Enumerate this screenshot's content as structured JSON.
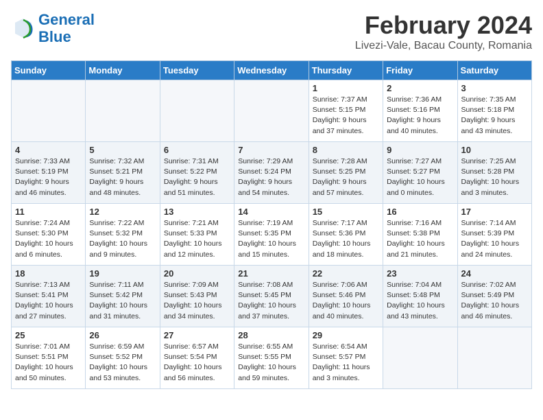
{
  "header": {
    "logo_line1": "General",
    "logo_line2": "Blue",
    "month": "February 2024",
    "location": "Livezi-Vale, Bacau County, Romania"
  },
  "weekdays": [
    "Sunday",
    "Monday",
    "Tuesday",
    "Wednesday",
    "Thursday",
    "Friday",
    "Saturday"
  ],
  "weeks": [
    [
      {
        "day": "",
        "info": ""
      },
      {
        "day": "",
        "info": ""
      },
      {
        "day": "",
        "info": ""
      },
      {
        "day": "",
        "info": ""
      },
      {
        "day": "1",
        "info": "Sunrise: 7:37 AM\nSunset: 5:15 PM\nDaylight: 9 hours\nand 37 minutes."
      },
      {
        "day": "2",
        "info": "Sunrise: 7:36 AM\nSunset: 5:16 PM\nDaylight: 9 hours\nand 40 minutes."
      },
      {
        "day": "3",
        "info": "Sunrise: 7:35 AM\nSunset: 5:18 PM\nDaylight: 9 hours\nand 43 minutes."
      }
    ],
    [
      {
        "day": "4",
        "info": "Sunrise: 7:33 AM\nSunset: 5:19 PM\nDaylight: 9 hours\nand 46 minutes."
      },
      {
        "day": "5",
        "info": "Sunrise: 7:32 AM\nSunset: 5:21 PM\nDaylight: 9 hours\nand 48 minutes."
      },
      {
        "day": "6",
        "info": "Sunrise: 7:31 AM\nSunset: 5:22 PM\nDaylight: 9 hours\nand 51 minutes."
      },
      {
        "day": "7",
        "info": "Sunrise: 7:29 AM\nSunset: 5:24 PM\nDaylight: 9 hours\nand 54 minutes."
      },
      {
        "day": "8",
        "info": "Sunrise: 7:28 AM\nSunset: 5:25 PM\nDaylight: 9 hours\nand 57 minutes."
      },
      {
        "day": "9",
        "info": "Sunrise: 7:27 AM\nSunset: 5:27 PM\nDaylight: 10 hours\nand 0 minutes."
      },
      {
        "day": "10",
        "info": "Sunrise: 7:25 AM\nSunset: 5:28 PM\nDaylight: 10 hours\nand 3 minutes."
      }
    ],
    [
      {
        "day": "11",
        "info": "Sunrise: 7:24 AM\nSunset: 5:30 PM\nDaylight: 10 hours\nand 6 minutes."
      },
      {
        "day": "12",
        "info": "Sunrise: 7:22 AM\nSunset: 5:32 PM\nDaylight: 10 hours\nand 9 minutes."
      },
      {
        "day": "13",
        "info": "Sunrise: 7:21 AM\nSunset: 5:33 PM\nDaylight: 10 hours\nand 12 minutes."
      },
      {
        "day": "14",
        "info": "Sunrise: 7:19 AM\nSunset: 5:35 PM\nDaylight: 10 hours\nand 15 minutes."
      },
      {
        "day": "15",
        "info": "Sunrise: 7:17 AM\nSunset: 5:36 PM\nDaylight: 10 hours\nand 18 minutes."
      },
      {
        "day": "16",
        "info": "Sunrise: 7:16 AM\nSunset: 5:38 PM\nDaylight: 10 hours\nand 21 minutes."
      },
      {
        "day": "17",
        "info": "Sunrise: 7:14 AM\nSunset: 5:39 PM\nDaylight: 10 hours\nand 24 minutes."
      }
    ],
    [
      {
        "day": "18",
        "info": "Sunrise: 7:13 AM\nSunset: 5:41 PM\nDaylight: 10 hours\nand 27 minutes."
      },
      {
        "day": "19",
        "info": "Sunrise: 7:11 AM\nSunset: 5:42 PM\nDaylight: 10 hours\nand 31 minutes."
      },
      {
        "day": "20",
        "info": "Sunrise: 7:09 AM\nSunset: 5:43 PM\nDaylight: 10 hours\nand 34 minutes."
      },
      {
        "day": "21",
        "info": "Sunrise: 7:08 AM\nSunset: 5:45 PM\nDaylight: 10 hours\nand 37 minutes."
      },
      {
        "day": "22",
        "info": "Sunrise: 7:06 AM\nSunset: 5:46 PM\nDaylight: 10 hours\nand 40 minutes."
      },
      {
        "day": "23",
        "info": "Sunrise: 7:04 AM\nSunset: 5:48 PM\nDaylight: 10 hours\nand 43 minutes."
      },
      {
        "day": "24",
        "info": "Sunrise: 7:02 AM\nSunset: 5:49 PM\nDaylight: 10 hours\nand 46 minutes."
      }
    ],
    [
      {
        "day": "25",
        "info": "Sunrise: 7:01 AM\nSunset: 5:51 PM\nDaylight: 10 hours\nand 50 minutes."
      },
      {
        "day": "26",
        "info": "Sunrise: 6:59 AM\nSunset: 5:52 PM\nDaylight: 10 hours\nand 53 minutes."
      },
      {
        "day": "27",
        "info": "Sunrise: 6:57 AM\nSunset: 5:54 PM\nDaylight: 10 hours\nand 56 minutes."
      },
      {
        "day": "28",
        "info": "Sunrise: 6:55 AM\nSunset: 5:55 PM\nDaylight: 10 hours\nand 59 minutes."
      },
      {
        "day": "29",
        "info": "Sunrise: 6:54 AM\nSunset: 5:57 PM\nDaylight: 11 hours\nand 3 minutes."
      },
      {
        "day": "",
        "info": ""
      },
      {
        "day": "",
        "info": ""
      }
    ]
  ]
}
